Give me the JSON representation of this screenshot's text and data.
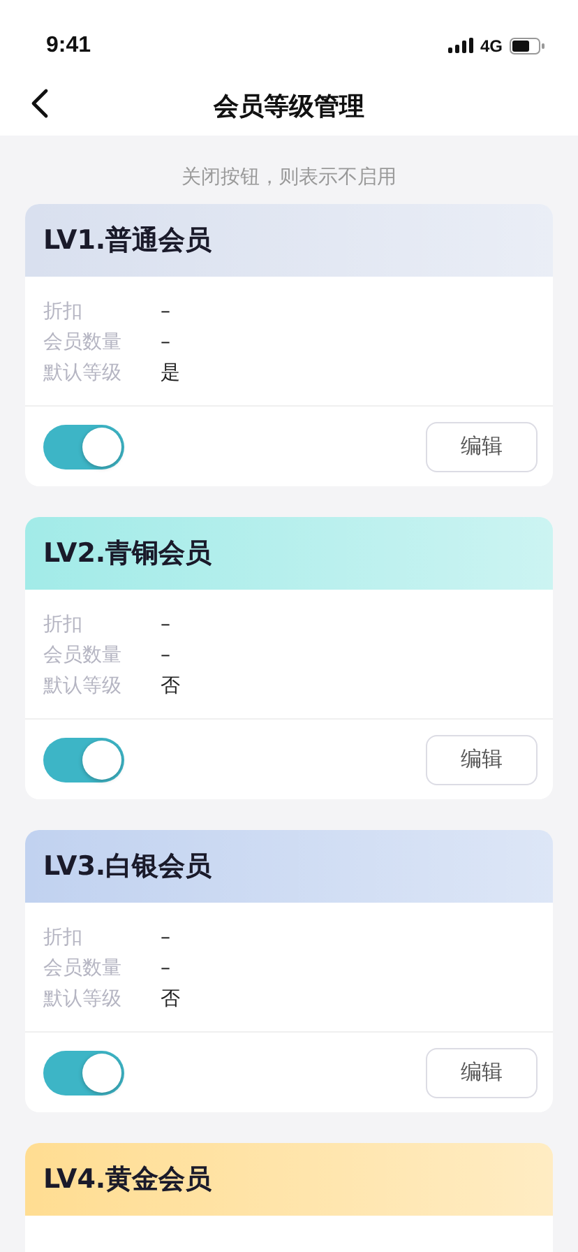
{
  "status_bar": {
    "time": "9:41",
    "network": "4G"
  },
  "nav": {
    "title": "会员等级管理"
  },
  "hint": "关闭按钮，则表示不启用",
  "levels": [
    {
      "title": "LV1.普通会员",
      "color": "#d9e0ef",
      "fields": [
        {
          "label": "折扣",
          "value": "–"
        },
        {
          "label": "会员数量",
          "value": "–"
        },
        {
          "label": "默认等级",
          "value": "是"
        }
      ],
      "on": true,
      "button": "编辑"
    },
    {
      "title": "LV2.青铜会员",
      "color": "#a2ebe8",
      "fields": [
        {
          "label": "折扣",
          "value": "–"
        },
        {
          "label": "会员数量",
          "value": "–"
        },
        {
          "label": "默认等级",
          "value": "否"
        }
      ],
      "on": true,
      "button": "编辑"
    },
    {
      "title": "LV3.白银会员",
      "color": "#c1d2f0",
      "fields": [
        {
          "label": "折扣",
          "value": "–"
        },
        {
          "label": "会员数量",
          "value": "–"
        },
        {
          "label": "默认等级",
          "value": "否"
        }
      ],
      "on": true,
      "button": "编辑"
    },
    {
      "title": "LV4.黄金会员",
      "color": "#ffdd92"
    }
  ]
}
